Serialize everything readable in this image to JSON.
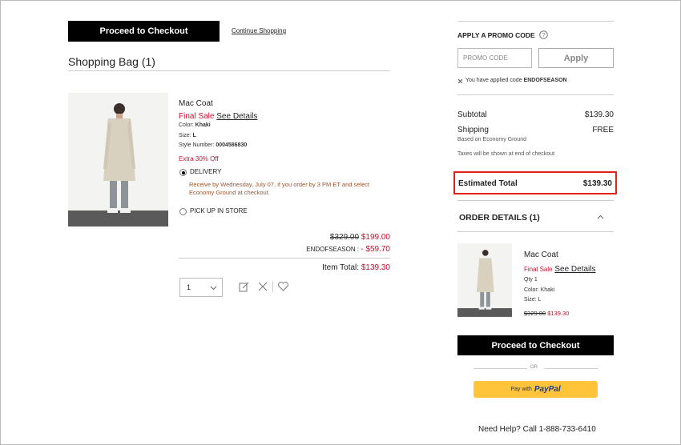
{
  "cart": {
    "checkout_label": "Proceed to Checkout",
    "continue_label": "Continue Shopping",
    "title": "Shopping Bag (1)"
  },
  "item": {
    "name": "Mac Coat",
    "final_sale": "Final Sale",
    "see_details": "See Details",
    "color_label": "Color:",
    "color_value": "Khaki",
    "size_label": "Size:",
    "size_value": "L",
    "style_label": "Style Number:",
    "style_value": "0004586830",
    "promo_note": "Extra 30% Off",
    "delivery_label": "DELIVERY",
    "delivery_note": "Receive by Wednesday, July 07, if you order by 3 PM ET and select Economy Ground at checkout.",
    "pickup_label": "PICK UP IN STORE",
    "original_price": "$329.00",
    "sale_price": "$199.00",
    "code_label": "ENDOFSEASON :",
    "code_discount": "- $59.70",
    "item_total_label": "Item Total:",
    "item_total_value": "$139.30",
    "qty": "1"
  },
  "promo": {
    "heading": "APPLY A PROMO CODE",
    "placeholder": "PROMO CODE",
    "apply_label": "Apply",
    "applied_prefix": "You have applied code",
    "applied_code": "ENDOFSEASON"
  },
  "summary": {
    "subtotal_label": "Subtotal",
    "subtotal_value": "$139.30",
    "shipping_label": "Shipping",
    "shipping_value": "FREE",
    "shipping_note": "Based on Economy Ground",
    "tax_note": "Taxes will be shown at end of checkout",
    "estimated_label": "Estimated Total",
    "estimated_value": "$139.30"
  },
  "order_details": {
    "heading": "ORDER DETAILS (1)",
    "name": "Mac Coat",
    "final_sale": "Final Sale",
    "see_details": "See Details",
    "qty": "Qty 1",
    "color": "Color: Khaki",
    "size": "Size: L",
    "original_price": "$329.00",
    "sale_price": "$139.30"
  },
  "checkout2_label": "Proceed to Checkout",
  "or_label": "OR",
  "paypal": {
    "prefix": "Pay with",
    "logo": "PayPal"
  },
  "help_text": "Need Help? Call 1-888-733-6410",
  "colors": {
    "accent_red": "#c8102e",
    "highlight_border": "#e2231a",
    "paypal_yellow": "#ffc439"
  }
}
